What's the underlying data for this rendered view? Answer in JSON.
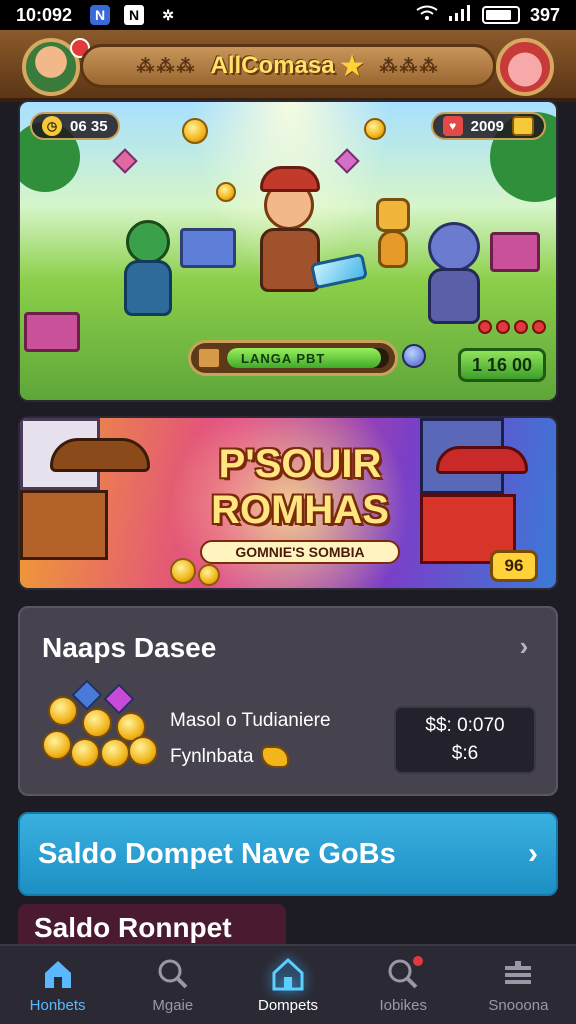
{
  "status_bar": {
    "time": "10:092",
    "battery_text": "397",
    "icons": [
      "app-icon",
      "app-icon",
      "settings-icon",
      "wifi-icon",
      "signal-icon",
      "battery-icon"
    ]
  },
  "header": {
    "title": "AllComasa",
    "left_deco": "⁂⁂⁂",
    "right_deco": "⁂⁂⁂"
  },
  "game": {
    "timer": "06 35",
    "coins": "2009",
    "progress_label": "LANGA PBT",
    "progress_level": 0.95,
    "score": "1 16 00",
    "lives": 4
  },
  "promo": {
    "title_line1": "P'SOUIR",
    "title_line2": "ROMHAS",
    "subtitle": "GOMNIE'S SOMBIA",
    "badge": "96"
  },
  "card": {
    "title": "Naaps Dasee",
    "line1": "Masol o Tudianiere",
    "line2": "Fynlnbata",
    "price1": "$$: 0:070",
    "price2": "$:6"
  },
  "cta": {
    "label": "Saldo Dompet Nave GoBs"
  },
  "section": {
    "label": "Saldo Ronnpet"
  },
  "nav": {
    "items": [
      {
        "label": "Honbets",
        "icon": "home-icon"
      },
      {
        "label": "Mgaie",
        "icon": "search-icon"
      },
      {
        "label": "Dompets",
        "icon": "home-icon"
      },
      {
        "label": "Iobikes",
        "icon": "search-icon"
      },
      {
        "label": "Snooona",
        "icon": "menu-icon"
      }
    ]
  },
  "colors": {
    "accent": "#5ab8ff",
    "cta": "#1d8fc4",
    "card": "#46434e",
    "background": "#1d1c24"
  }
}
